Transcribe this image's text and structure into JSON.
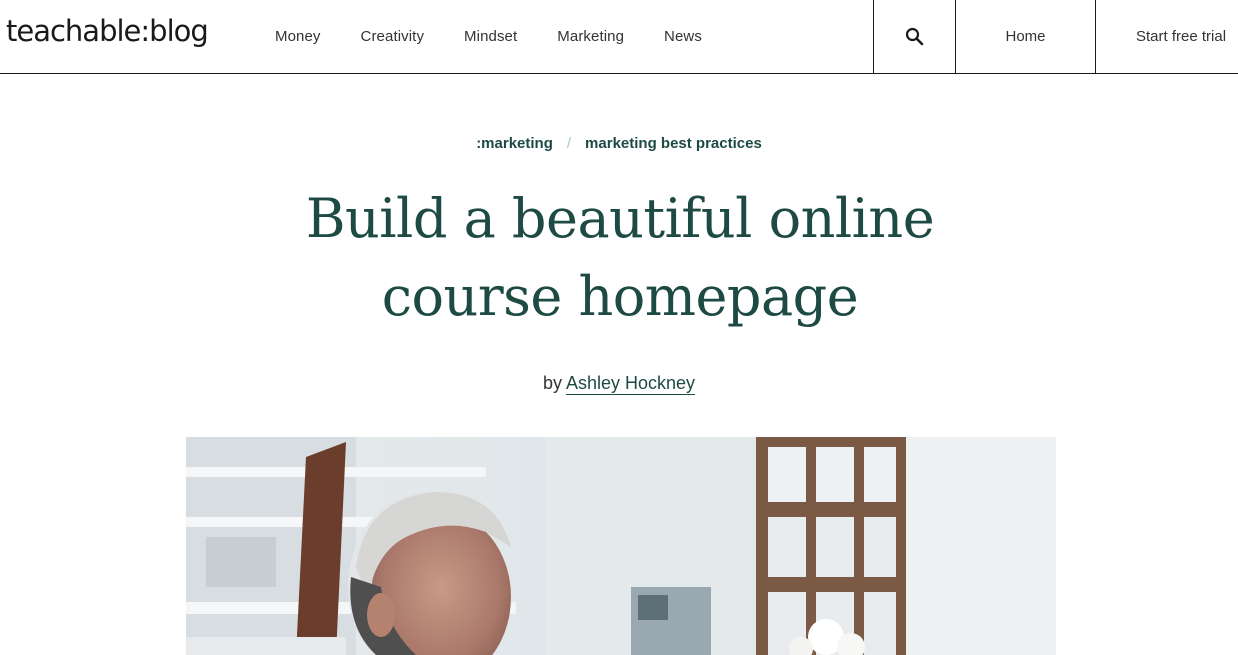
{
  "header": {
    "logo": "teachable:blog",
    "nav": [
      "Money",
      "Creativity",
      "Mindset",
      "Marketing",
      "News"
    ],
    "search_icon": "search-icon",
    "home_label": "Home",
    "trial_label": "Start free trial"
  },
  "article": {
    "breadcrumb": {
      "category": ":marketing",
      "separator": "/",
      "subcategory": "marketing best practices"
    },
    "title_line1": "Build a beautiful online",
    "title_line2": "course homepage",
    "by_prefix": "by",
    "author": "Ashley Hockney",
    "hero_image": "photo-man-in-workshop"
  },
  "colors": {
    "heading": "#1e4a44",
    "separator": "#9fc9c4",
    "border": "#1a1a1a"
  }
}
